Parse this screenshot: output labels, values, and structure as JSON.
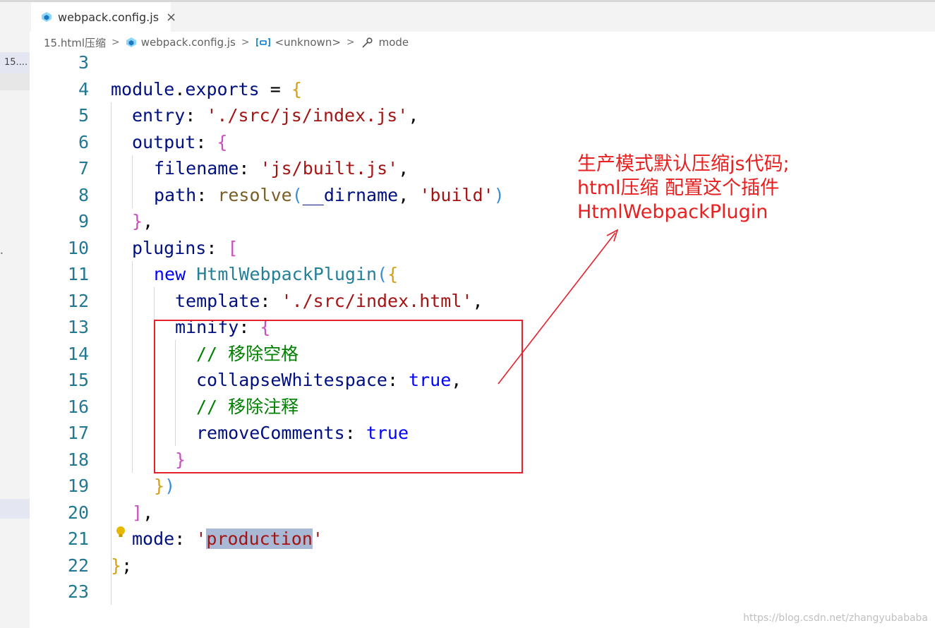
{
  "tab": {
    "label": "webpack.config.js",
    "close": "×"
  },
  "sidebar": {
    "item_label": "15...."
  },
  "breadcrumb": {
    "items": [
      "15.html压缩",
      "webpack.config.js",
      "<unknown>",
      "mode"
    ],
    "separator": ">"
  },
  "editor": {
    "line_numbers": [
      "3",
      "4",
      "5",
      "6",
      "7",
      "8",
      "9",
      "10",
      "11",
      "12",
      "13",
      "14",
      "15",
      "16",
      "17",
      "18",
      "19",
      "20",
      "21",
      "22",
      "23"
    ],
    "lines": {
      "l4": [
        "module",
        ".",
        "exports",
        " = ",
        "{"
      ],
      "l5": [
        "entry",
        ": ",
        "'./src/js/index.js'",
        ","
      ],
      "l6": [
        "output",
        ": ",
        "{"
      ],
      "l7": [
        "filename",
        ": ",
        "'js/built.js'",
        ","
      ],
      "l8": [
        "path",
        ": ",
        "resolve",
        "(",
        "__dirname",
        ", ",
        "'build'",
        ")"
      ],
      "l9": [
        "}",
        ","
      ],
      "l10": [
        "plugins",
        ": ",
        "["
      ],
      "l11": [
        "new",
        " ",
        "HtmlWebpackPlugin",
        "(",
        "{"
      ],
      "l12": [
        "template",
        ": ",
        "'./src/index.html'",
        ","
      ],
      "l13": [
        "minify",
        ": ",
        "{"
      ],
      "l14": [
        "// 移除空格"
      ],
      "l15": [
        "collapseWhitespace",
        ": ",
        "true",
        ","
      ],
      "l16": [
        "// 移除注释"
      ],
      "l17": [
        "removeComments",
        ": ",
        "true"
      ],
      "l18": [
        "}"
      ],
      "l19": [
        "}",
        ")"
      ],
      "l20": [
        "]",
        ","
      ],
      "l21": [
        "mode",
        ": ",
        "'",
        "production",
        "'"
      ],
      "l22": [
        "}",
        ";"
      ]
    }
  },
  "annotation": {
    "lines": [
      "生产模式默认压缩js代码;",
      "html压缩 配置这个插件",
      "HtmlWebpackPlugin"
    ],
    "color": "#e82020"
  },
  "watermark": "https://blog.csdn.net/zhangyubababa",
  "colors": {
    "keyword": "#0000ff",
    "string": "#a31515",
    "property": "#001080",
    "function": "#795e26",
    "class": "#267f99",
    "comment": "#008000",
    "line_number": "#237893",
    "annotation_red": "#e3222b"
  },
  "icons": {
    "tab_icon": "webpack-cube-icon",
    "bc_file_icon": "webpack-cube-icon",
    "bc_symbol_icon": "variable-symbol-icon",
    "bc_property_icon": "wrench-icon",
    "lightbulb": "lightbulb-icon"
  }
}
